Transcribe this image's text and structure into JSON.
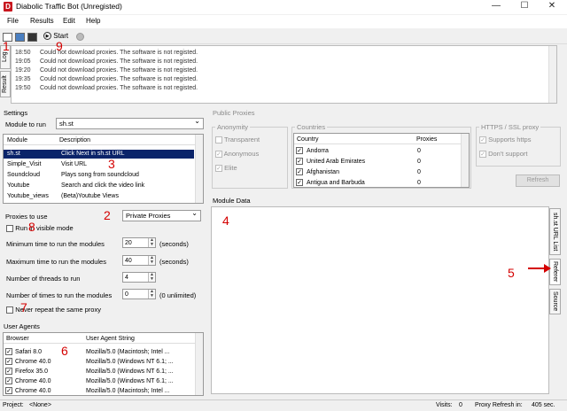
{
  "title": "Diabolic Traffic Bot (Unregisted)",
  "menu": [
    "File",
    "Results",
    "Edit",
    "Help"
  ],
  "toolbar": {
    "start_label": "Start"
  },
  "annotations": {
    "a1": "1",
    "a2": "2",
    "a3": "3",
    "a4": "4",
    "a5": "5",
    "a6": "6",
    "a7": "7",
    "a8": "8",
    "a9": "9"
  },
  "side_tabs": {
    "log": "Log",
    "result": "Result"
  },
  "log": [
    {
      "time": "18:50",
      "msg": "Could not download proxies. The software is not registed."
    },
    {
      "time": "19:05",
      "msg": "Could not download proxies. The software is not registed."
    },
    {
      "time": "19:20",
      "msg": "Could not download proxies. The software is not registed."
    },
    {
      "time": "19:35",
      "msg": "Could not download proxies. The software is not registed."
    },
    {
      "time": "19:50",
      "msg": "Could not download proxies. The software is not registed."
    }
  ],
  "settings": {
    "label": "Settings",
    "module_to_run_label": "Module to run",
    "module_to_run_value": "sh.st",
    "modules_header": {
      "module": "Module",
      "description": "Description"
    },
    "modules": [
      {
        "module": "sh.st",
        "description": "Click Next in sh.st URL"
      },
      {
        "module": "Simple_Visit",
        "description": "Visit URL"
      },
      {
        "module": "Soundcloud",
        "description": "Plays song from soundcloud"
      },
      {
        "module": "Youtube",
        "description": "Search and click the video link"
      },
      {
        "module": "Youtube_views",
        "description": "(Beta)Youtube Views"
      }
    ],
    "proxies_label": "Proxies to use",
    "proxies_value": "Private Proxies",
    "run_visible_label": "Run in visible mode",
    "min_time_label": "Minimum time to run the modules",
    "min_time_value": "20",
    "max_time_label": "Maximum time to run the modules",
    "max_time_value": "40",
    "seconds_label": "(seconds)",
    "threads_label": "Number of threads to run",
    "threads_value": "4",
    "times_label": "Number of times to run the modules",
    "times_value": "0",
    "unlimited_label": "(0 unlimited)",
    "never_repeat_label": "Never repeat the same proxy"
  },
  "public_proxies": {
    "label": "Public Proxies",
    "anonymity_label": "Anonymity",
    "anonymity_options": [
      "Transparent",
      "Anonymous",
      "Elite"
    ],
    "countries_label": "Countries",
    "countries_header": {
      "country": "Country",
      "proxies": "Proxies"
    },
    "countries": [
      {
        "name": "Andorra",
        "proxies": "0"
      },
      {
        "name": "United Arab Emirates",
        "proxies": "0"
      },
      {
        "name": "Afghanistan",
        "proxies": "0"
      },
      {
        "name": "Antigua and Barbuda",
        "proxies": "0"
      }
    ],
    "ssl_label": "HTTPS / SSL proxy",
    "ssl_options": [
      "Supports https",
      "Don't support"
    ],
    "refresh_label": "Refresh"
  },
  "module_data": {
    "label": "Module Data",
    "tabs": [
      "sh.st URL List",
      "Referer",
      "Source"
    ]
  },
  "user_agents": {
    "label": "User Agents",
    "header": {
      "browser": "Browser",
      "ua": "User Agent String"
    },
    "rows": [
      {
        "browser": "Safari 8.0",
        "ua": "Mozilla/5.0 (Macintosh; Intel ..."
      },
      {
        "browser": "Chrome 40.0",
        "ua": "Mozilla/5.0 (Windows NT 6.1; ..."
      },
      {
        "browser": "Firefox 35.0",
        "ua": "Mozilla/5.0 (Windows NT 6.1; ..."
      },
      {
        "browser": "Chrome 40.0",
        "ua": "Mozilla/5.0 (Windows NT 6.1; ..."
      },
      {
        "browser": "Chrome 40.0",
        "ua": "Mozilla/5.0 (Macintosh; Intel ..."
      }
    ]
  },
  "status": {
    "project_label": "Project:",
    "project_value": "<None>",
    "visits_label": "Visits:",
    "visits_value": "0",
    "refresh_label": "Proxy Refresh in:",
    "refresh_value": "405 sec."
  },
  "colors": {
    "annotation": "#d40000",
    "selection": "#0a246a",
    "app_icon": "#c8171e"
  }
}
